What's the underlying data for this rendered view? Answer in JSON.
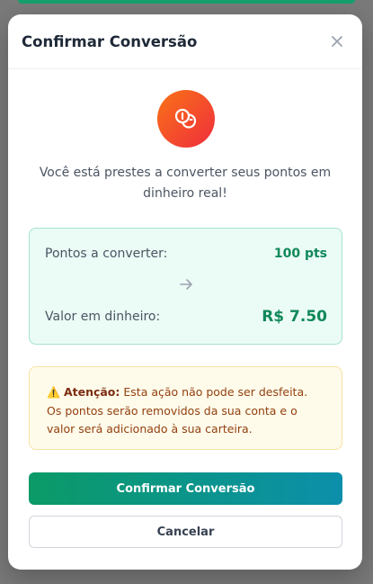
{
  "modal": {
    "title": "Confirmar Conversão",
    "close_icon": "close-icon",
    "hero_icon": "coins-icon",
    "message": "Você está prestes a converter seus pontos em dinheiro real!"
  },
  "conversion": {
    "points_label": "Pontos a converter:",
    "points_value": "100 pts",
    "arrow_icon": "arrow-right-icon",
    "money_label": "Valor em dinheiro:",
    "money_value": "R$ 7.50"
  },
  "warning": {
    "icon": "⚠️",
    "title": "Atenção:",
    "text": "Esta ação não pode ser desfeita. Os pontos serão removidos da sua conta e o valor será adicionado à sua carteira."
  },
  "buttons": {
    "confirm_label": "Confirmar Conversão",
    "cancel_label": "Cancelar"
  },
  "colors": {
    "accent_green": "#10885a",
    "gradient_start": "#0b9a67",
    "gradient_end": "#0b8fab",
    "hero_gradient_start": "#f97316",
    "hero_gradient_end": "#ef2d3d"
  }
}
